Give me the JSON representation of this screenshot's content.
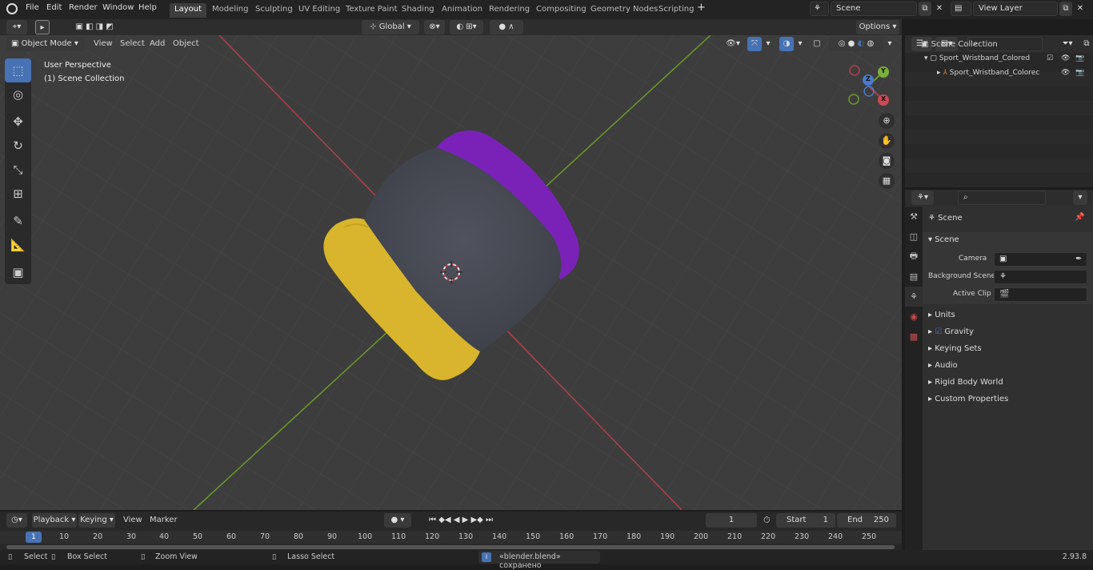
{
  "menu": {
    "file": "File",
    "edit": "Edit",
    "render": "Render",
    "window": "Window",
    "help": "Help"
  },
  "workspaces": [
    "Layout",
    "Modeling",
    "Sculpting",
    "UV Editing",
    "Texture Paint",
    "Shading",
    "Animation",
    "Rendering",
    "Compositing",
    "Geometry Nodes",
    "Scripting"
  ],
  "scene": {
    "label": "Scene"
  },
  "view_layer": {
    "label": "View Layer"
  },
  "viewport_header": {
    "mode": "Object Mode",
    "view": "View",
    "select": "Select",
    "add": "Add",
    "object": "Object",
    "orientation": "Global",
    "options": "Options"
  },
  "overlay_text": {
    "perspective": "User Perspective",
    "collection": "(1) Scene Collection"
  },
  "gizmo": {
    "x": "X",
    "y": "Y",
    "z": "Z"
  },
  "outliner": {
    "root": "Scene Collection",
    "items": [
      {
        "label": "Sport_Wristband_Colored"
      },
      {
        "label": "Sport_Wristband_Colorec"
      }
    ]
  },
  "properties": {
    "header": "Scene",
    "section": "Scene",
    "camera_label": "Camera",
    "bg_scene_label": "Background Scene",
    "active_clip_label": "Active Clip",
    "panels": [
      "Units",
      "Gravity",
      "Keying Sets",
      "Audio",
      "Rigid Body World",
      "Custom Properties"
    ]
  },
  "timeline": {
    "playback": "Playback",
    "keying": "Keying",
    "view": "View",
    "marker": "Marker",
    "current_frame": "1",
    "start_label": "Start",
    "start": "1",
    "end_label": "End",
    "end": "250",
    "ticks": [
      "1",
      "10",
      "20",
      "30",
      "40",
      "50",
      "60",
      "70",
      "80",
      "90",
      "100",
      "110",
      "120",
      "130",
      "140",
      "150",
      "160",
      "170",
      "180",
      "190",
      "200",
      "210",
      "220",
      "230",
      "240",
      "250"
    ]
  },
  "status": {
    "select": "Select",
    "box_select": "Box Select",
    "zoom_view": "Zoom View",
    "lasso_select": "Lasso Select",
    "message": "«blender.blend» сохранено",
    "version": "2.93.8"
  },
  "colors": {
    "accent": "#4772b3",
    "purple": "#7a22b8",
    "yellow": "#d8b52c",
    "band": "#4a4c56",
    "x_axis": "#b2404c",
    "y_axis": "#6a9a2a"
  },
  "icons": {
    "select": "select-box-icon",
    "cursor": "cursor-icon",
    "move": "move-icon",
    "rotate": "rotate-icon",
    "scale": "scale-icon",
    "transform": "transform-icon",
    "annotate": "annotate-icon",
    "measure": "measure-icon",
    "add_cube": "add-cube-icon"
  }
}
